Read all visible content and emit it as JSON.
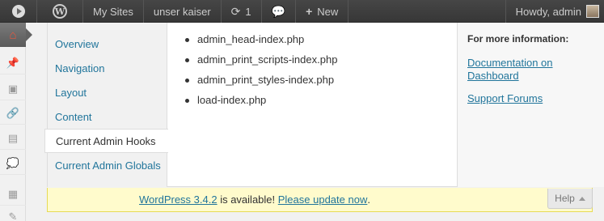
{
  "adminbar": {
    "my_sites": "My Sites",
    "site_name": "unser kaiser",
    "updates_count": "1",
    "new_label": "New",
    "howdy": "Howdy, admin"
  },
  "help_tabs": [
    {
      "label": "Overview"
    },
    {
      "label": "Navigation"
    },
    {
      "label": "Layout"
    },
    {
      "label": "Content"
    },
    {
      "label": "Current Admin Hooks"
    },
    {
      "label": "Current Admin Globals"
    }
  ],
  "help_content": {
    "hooks": [
      "admin_head-index.php",
      "admin_print_scripts-index.php",
      "admin_print_styles-index.php",
      "load-index.php"
    ]
  },
  "help_sidebar": {
    "heading": "For more information:",
    "doc_link": "Documentation on Dashboard",
    "forums_link": "Support Forums"
  },
  "update_nag": {
    "version_link": "WordPress 3.4.2",
    "middle_text": " is available! ",
    "update_link": "Please update now",
    "end_text": "."
  },
  "help_button": {
    "label": "Help"
  },
  "colors": {
    "link": "#21759b",
    "adminbar": "#464646",
    "nag_bg": "#fffbcc"
  }
}
